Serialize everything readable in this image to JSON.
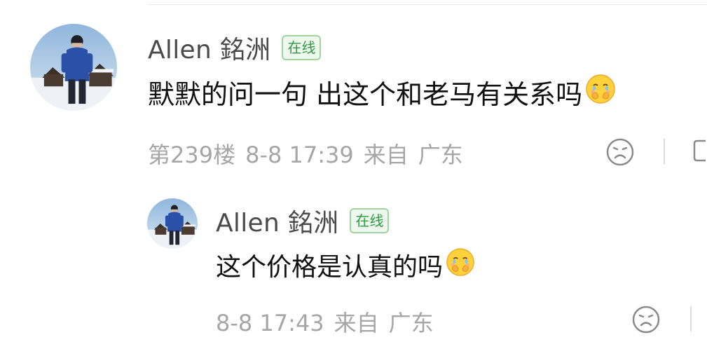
{
  "comment": {
    "user_name": "Allen 銘洲",
    "online_badge": "在线",
    "text": "默默的问一句 出这个和老马有关系吗",
    "floor": "第239楼",
    "date": "8-8 17:39",
    "from": "来自",
    "location": "广东"
  },
  "reply": {
    "user_name": "Allen 銘洲",
    "online_badge": "在线",
    "text": "这个价格是认真的吗",
    "date": "8-8 17:43",
    "from": "来自",
    "location": "广东"
  },
  "icons": {
    "emoji": "face-holding-back-tears-emoji",
    "react": "sad-face-icon",
    "reply": "comment-bubble-icon"
  },
  "colors": {
    "online_badge_text": "#2e9a43",
    "online_badge_border": "#9fd49f",
    "meta_text": "#a6a6a6"
  }
}
